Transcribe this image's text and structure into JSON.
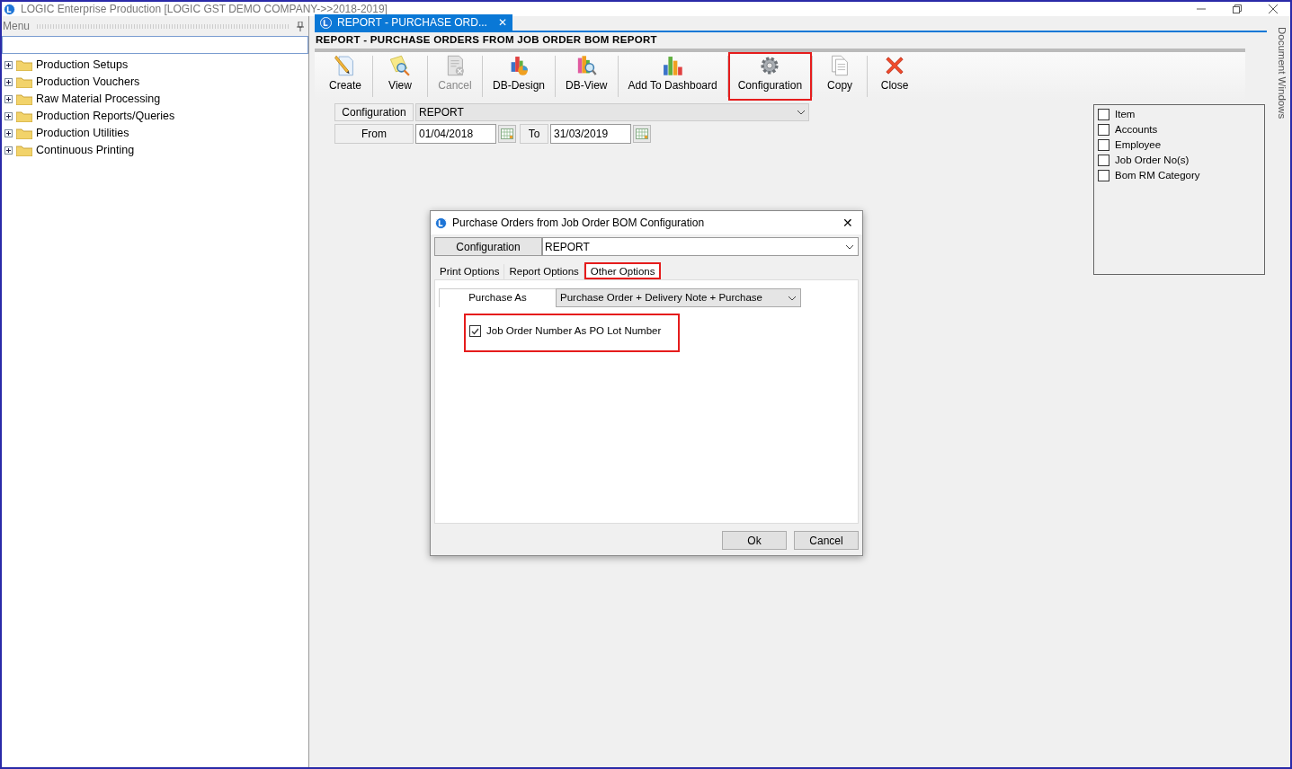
{
  "window": {
    "title": "LOGIC Enterprise Production  [LOGIC GST DEMO COMPANY->>2018-2019]"
  },
  "menu_panel": {
    "title": "Menu",
    "items": [
      {
        "label": "Production Setups",
        "expanded": false
      },
      {
        "label": "Production Vouchers",
        "expanded": false
      },
      {
        "label": "Raw Material Processing",
        "expanded": false
      },
      {
        "label": "Production Reports/Queries",
        "expanded": false
      },
      {
        "label": "Production Utilities",
        "expanded": false
      },
      {
        "label": "Continuous Printing",
        "expanded": false
      }
    ]
  },
  "document_tabs": [
    {
      "label": "REPORT - PURCHASE ORD...",
      "selected": true,
      "close": "✕"
    }
  ],
  "report": {
    "title": "REPORT - PURCHASE ORDERS FROM JOB ORDER BOM REPORT",
    "toolbar": [
      {
        "kind": "create",
        "label": "Create",
        "disabled": false,
        "highlighted": false
      },
      {
        "kind": "view",
        "label": "View",
        "disabled": false,
        "highlighted": false
      },
      {
        "kind": "cancel",
        "label": "Cancel",
        "disabled": true,
        "highlighted": false
      },
      {
        "kind": "db-design",
        "label": "DB-Design",
        "disabled": false,
        "highlighted": false
      },
      {
        "kind": "db-view",
        "label": "DB-View",
        "disabled": false,
        "highlighted": false
      },
      {
        "kind": "dashboard",
        "label": "Add To Dashboard",
        "disabled": false,
        "highlighted": false
      },
      {
        "kind": "configuration",
        "label": "Configuration",
        "disabled": false,
        "highlighted": true
      },
      {
        "kind": "copy",
        "label": "Copy",
        "disabled": false,
        "highlighted": false
      },
      {
        "kind": "close",
        "label": "Close",
        "disabled": false,
        "highlighted": false
      }
    ],
    "configuration": {
      "label": "Configuration",
      "value": "REPORT"
    },
    "from": {
      "label": "From",
      "value": "01/04/2018"
    },
    "to": {
      "label": "To",
      "value": "31/03/2019"
    },
    "filters": [
      {
        "label": "Item",
        "checked": false
      },
      {
        "label": "Accounts",
        "checked": false
      },
      {
        "label": "Employee",
        "checked": false
      },
      {
        "label": "Job Order No(s)",
        "checked": false
      },
      {
        "label": "Bom RM Category",
        "checked": false
      }
    ]
  },
  "side_panel": {
    "label": "Document Windows"
  },
  "dialog": {
    "title": "Purchase Orders from Job Order BOM Configuration",
    "close": "✕",
    "configuration": {
      "label": "Configuration",
      "value": "REPORT"
    },
    "tabs": [
      {
        "label": "Print Options",
        "selected": false,
        "highlighted": false
      },
      {
        "label": "Report Options",
        "selected": false,
        "highlighted": false
      },
      {
        "label": "Other Options",
        "selected": true,
        "highlighted": true
      }
    ],
    "purchase_as": {
      "label": "Purchase As",
      "value": "Purchase Order + Delivery Note + Purchase"
    },
    "options": [
      {
        "label": "Job Order Number As PO Lot Number",
        "checked": true,
        "highlighted": true
      }
    ],
    "buttons": [
      "Ok",
      "Cancel"
    ]
  }
}
